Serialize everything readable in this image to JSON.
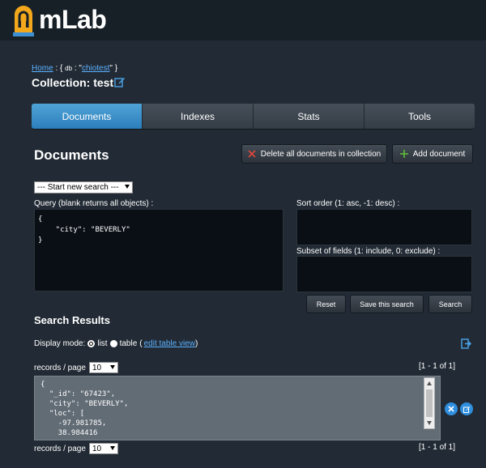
{
  "brand": {
    "name": "mLab"
  },
  "breadcrumb": {
    "home": "Home",
    "prefix": " : { ",
    "db_key": "db",
    "sep": " : \"",
    "db_name": "chiotest",
    "suffix": "\" }"
  },
  "collection": {
    "title": "Collection: test"
  },
  "tabs": [
    {
      "label": "Documents",
      "active": true
    },
    {
      "label": "Indexes",
      "active": false
    },
    {
      "label": "Stats",
      "active": false
    },
    {
      "label": "Tools",
      "active": false
    }
  ],
  "documents": {
    "title": "Documents",
    "delete_all_label": "Delete all documents in collection",
    "add_label": "Add document"
  },
  "search": {
    "selected": "--- Start new search ---",
    "query_label": "Query (blank returns all objects) :",
    "query_value": "{\n    \"city\": \"BEVERLY\"\n}",
    "sort_label": "Sort order (1: asc, -1: desc) :",
    "sort_value": "",
    "fields_label": "Subset of fields (1: include, 0: exclude) :",
    "fields_value": "",
    "reset_label": "Reset",
    "save_label": "Save this search",
    "search_label": "Search"
  },
  "results": {
    "title": "Search Results",
    "display_mode_label": "Display mode:",
    "mode_list": "list",
    "mode_table": "table",
    "paren_open": "(",
    "edit_table_view": "edit table view",
    "paren_close": ")",
    "records_label": "records / page",
    "page_size": "10",
    "range": "[1 - 1 of 1]",
    "record_text": "{\n  \"_id\": \"67423\",\n  \"city\": \"BEVERLY\",\n  \"loc\": [\n    -97.981785,\n    38.984416"
  },
  "colors": {
    "accent": "#2c7ebc",
    "background": "#222b35",
    "topbar": "#182027",
    "link": "#5cb0ff"
  }
}
